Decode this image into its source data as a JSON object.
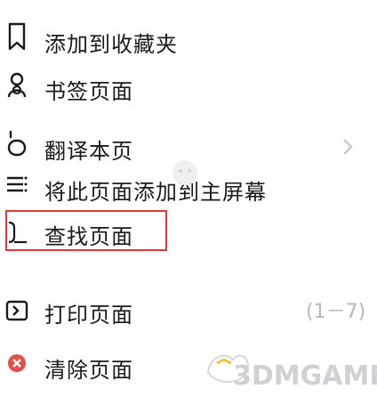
{
  "menu": {
    "items": [
      {
        "label": "添加到收藏夹",
        "icon": "bookmark-icon"
      },
      {
        "label": "书签页面",
        "icon": "share-icon"
      },
      {
        "label": "翻译本页",
        "icon": "translate-icon"
      },
      {
        "label": "将此页面添加到主屏幕",
        "icon": "add-to-home-icon"
      },
      {
        "label": "查找页面",
        "icon": "find-in-page-icon"
      },
      {
        "label": "打印页面",
        "icon": "print-icon"
      },
      {
        "label": "清除页面",
        "icon": "clear-icon"
      }
    ]
  },
  "counter": "(1－7)",
  "watermark": "3DMGAME",
  "colors": {
    "highlight": "#e03a36",
    "clear_icon": "#e2504c",
    "text": "#1a1a1a",
    "muted": "#b8b8b8"
  }
}
